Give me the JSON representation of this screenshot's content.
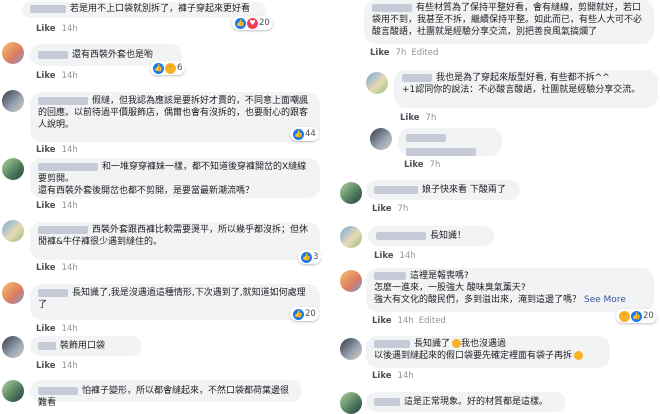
{
  "meta": {
    "like": "Like",
    "edited": "Edited",
    "see_more": "See More"
  },
  "left": [
    {
      "text": "若是用不上口袋就別拆了，褲子穿起來更好看",
      "ago": "14h",
      "reactions": "20"
    },
    {
      "text": "還有西裝外套也是喲",
      "ago": "14h",
      "reactions": "6"
    },
    {
      "text": "假縫，但我認為應該是要拆好才賣的，不同意上面嘲諷的回應。以前待過平價服飾店，偶爾也會有沒拆的，也要耐心的跟客人說明。",
      "ago": "14h",
      "reactions": "44"
    },
    {
      "text1": "和一堆穿穿褲妹一樣，都不知道後穿褲開岔的X縫線要剪開。",
      "text2": "還有西裝外套後開岔也都不剪開，是要當最新潮流嗎？",
      "ago": "14h",
      "reactions": ""
    },
    {
      "text": "西裝外套跟西褲比較需要燙平，所以幾乎都沒拆；但休閒褲&牛仔褲很少遇到縫住的。",
      "ago": "14h",
      "reactions": "3"
    },
    {
      "text": "長知識了,我是沒遇過這種情形,下次遇到了,就知道如何處理了",
      "ago": "14h",
      "reactions": "20"
    },
    {
      "text": "裝飾用口袋",
      "ago": "14h",
      "reactions": ""
    },
    {
      "text": "怕褲子變形，所以都會縫起來，不然口袋都荷葉邊很難看",
      "ago": "",
      "reactions": ""
    }
  ],
  "right": [
    {
      "text": "有些材質為了保持平整好看，會有縫線，剪開就好，若口袋用不到，我甚至不拆，繼續保持平整。如此而已，有些人大可不必酸言酸語，社團就是經驗分享交流，別把善良風氣搞爛了",
      "ago": "7h",
      "reactions": ""
    },
    {
      "text": "我也是為了穿起來版型好看, 有些都不拆^^",
      "text2": "+1認同你的說法：不必酸言酸語，社團就是經驗分享交流。",
      "ago": "7h",
      "reactions": ""
    },
    {
      "text": "",
      "ago": "7h",
      "reactions": ""
    },
    {
      "text": "娘子快來看 下酸兩了",
      "ago": "7h",
      "reactions": ""
    },
    {
      "text": "長知識！",
      "ago": "14h",
      "reactions": ""
    },
    {
      "text1": "這裡是報喪嗎?",
      "text2": "怎麼一進來，一股強大 酸味臭氣薰天?",
      "text3": "強大有文化的酸民們，多到溢出來，淹到這邊了嗎？",
      "ago": "14h",
      "reactions": "20"
    },
    {
      "text1": "長知識了",
      "text1b": "我也沒遇過",
      "text2": "以後遇到縫起來的假口袋要先確定裡面有袋子再拆",
      "ago": "14h",
      "reactions": ""
    },
    {
      "text": "這是正常現象。好的材質都是這樣。",
      "ago": "",
      "reactions": ""
    }
  ]
}
